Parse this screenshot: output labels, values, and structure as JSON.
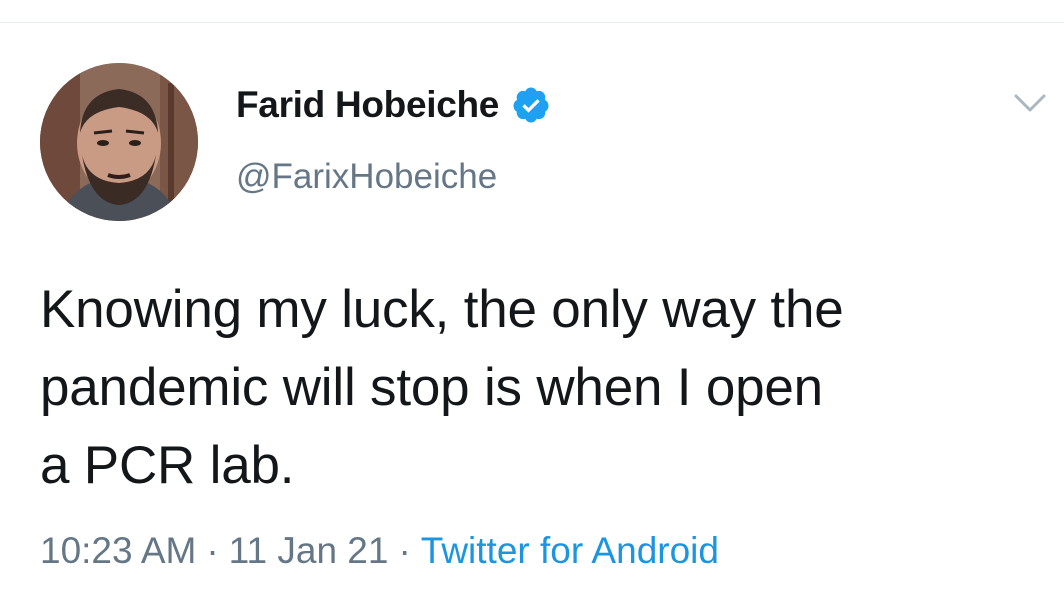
{
  "author": {
    "display_name": "Farid Hobeiche",
    "handle": "@FarixHobeiche",
    "verified": true
  },
  "tweet": {
    "text_lines": [
      "Knowing my luck, the only way the",
      "pandemic will stop is when I open",
      "a PCR lab."
    ],
    "time": "10:23 AM",
    "date": "11 Jan 21",
    "separator": "·",
    "source": "Twitter for Android"
  },
  "icons": {
    "verified": "verified-badge-icon",
    "menu": "chevron-down-icon"
  },
  "colors": {
    "verified_blue": "#1da1f2",
    "link_blue": "#1b95e0",
    "secondary_text": "#657786",
    "primary_text": "#14171a"
  }
}
